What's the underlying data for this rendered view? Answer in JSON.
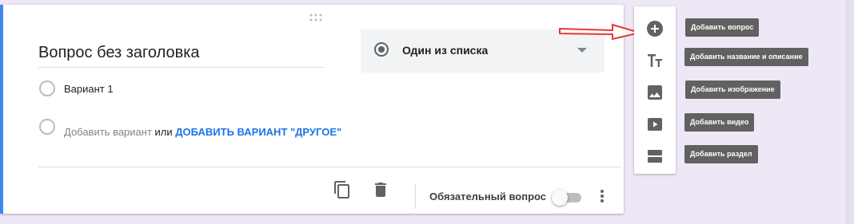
{
  "question": {
    "title": "Вопрос без заголовка",
    "type_label": "Один из списка",
    "options": [
      {
        "label": "Вариант 1"
      }
    ],
    "add_option_text": "Добавить вариант",
    "or_text": "или",
    "add_other_link": "ДОБАВИТЬ ВАРИАНТ \"ДРУГОЕ\"",
    "required_label": "Обязательный вопрос",
    "required_on": false
  },
  "toolbar": {
    "items": [
      {
        "icon": "add-circle-icon",
        "tooltip": "Добавить вопрос"
      },
      {
        "icon": "title-text-icon",
        "tooltip": "Добавить название и описание"
      },
      {
        "icon": "image-icon",
        "tooltip": "Добавить изображение"
      },
      {
        "icon": "video-icon",
        "tooltip": "Добавить видео"
      },
      {
        "icon": "section-icon",
        "tooltip": "Добавить раздел"
      }
    ]
  },
  "colors": {
    "accent": "#4285f4",
    "link": "#1a73e8",
    "background": "#ede7f6",
    "annotation_arrow": "#e53935"
  }
}
